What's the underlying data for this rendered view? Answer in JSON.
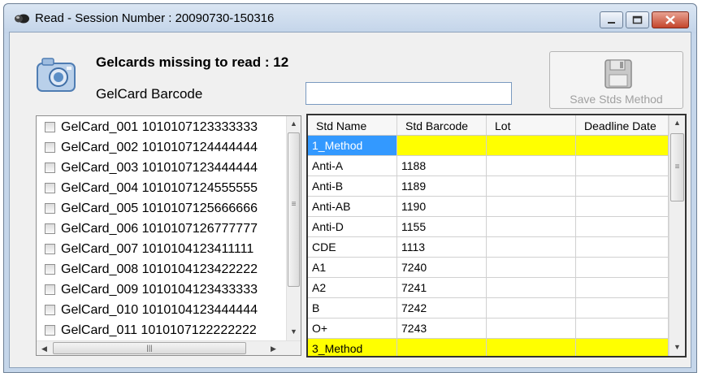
{
  "window": {
    "title": "Read  -  Session Number : 20090730-150316"
  },
  "header": {
    "missing_text": "Gelcards missing to read :  12",
    "barcode_label": "GelCard Barcode",
    "barcode_value": ""
  },
  "save_button": {
    "label": "Save Stds Method"
  },
  "gelcards": [
    {
      "label": "GelCard_001 1010107123333333",
      "checked": false
    },
    {
      "label": "GelCard_002 1010107124444444",
      "checked": false
    },
    {
      "label": "GelCard_003 1010107123444444",
      "checked": false
    },
    {
      "label": "GelCard_004 1010107124555555",
      "checked": false
    },
    {
      "label": "GelCard_005 1010107125666666",
      "checked": false
    },
    {
      "label": "GelCard_006 1010107126777777",
      "checked": false
    },
    {
      "label": "GelCard_007 1010104123411111",
      "checked": false
    },
    {
      "label": "GelCard_008 1010104123422222",
      "checked": false
    },
    {
      "label": "GelCard_009 1010104123433333",
      "checked": false
    },
    {
      "label": "GelCard_010 1010104123444444",
      "checked": false
    },
    {
      "label": "GelCard_011 1010107122222222",
      "checked": false
    }
  ],
  "grid": {
    "columns": [
      "Std Name",
      "Std Barcode",
      "Lot",
      "Deadline Date"
    ],
    "rows": [
      {
        "name": "1_Method",
        "barcode": "",
        "lot": "",
        "deadline": "",
        "method": true,
        "selected": true
      },
      {
        "name": "Anti-A",
        "barcode": "1188",
        "lot": "",
        "deadline": ""
      },
      {
        "name": "Anti-B",
        "barcode": "1189",
        "lot": "",
        "deadline": ""
      },
      {
        "name": "Anti-AB",
        "barcode": "1190",
        "lot": "",
        "deadline": ""
      },
      {
        "name": "Anti-D",
        "barcode": "1155",
        "lot": "",
        "deadline": ""
      },
      {
        "name": "CDE",
        "barcode": "1113",
        "lot": "",
        "deadline": ""
      },
      {
        "name": "A1",
        "barcode": "7240",
        "lot": "",
        "deadline": ""
      },
      {
        "name": "A2",
        "barcode": "7241",
        "lot": "",
        "deadline": ""
      },
      {
        "name": "B",
        "barcode": "7242",
        "lot": "",
        "deadline": ""
      },
      {
        "name": "O+",
        "barcode": "7243",
        "lot": "",
        "deadline": ""
      },
      {
        "name": "3_Method",
        "barcode": "",
        "lot": "",
        "deadline": "",
        "method": true
      }
    ]
  },
  "colors": {
    "method_row": "#ffff00",
    "selected_cell": "#3399ff"
  }
}
